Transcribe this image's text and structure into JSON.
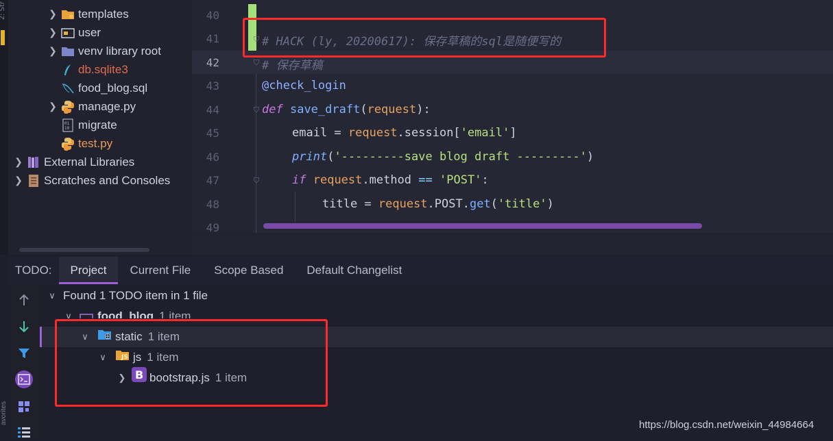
{
  "left_strip": {
    "vertical_text": "2: Str"
  },
  "project_tree": {
    "items": [
      {
        "label": "templates",
        "icon": "folder-icon"
      },
      {
        "label": "user",
        "icon": "folder-icon"
      },
      {
        "label": "venv  library root",
        "icon": "folder-icon"
      },
      {
        "label": "db.sqlite3",
        "icon": "feather-icon"
      },
      {
        "label": "food_blog.sql",
        "icon": "sql-file-icon"
      },
      {
        "label": "manage.py",
        "icon": "python-icon"
      },
      {
        "label": "migrate",
        "icon": "binary-file-icon"
      },
      {
        "label": "test.py",
        "icon": "python-icon"
      },
      {
        "label": "External Libraries",
        "icon": "library-icon"
      },
      {
        "label": "Scratches and Consoles",
        "icon": "scratches-icon"
      }
    ]
  },
  "editor": {
    "line_numbers": [
      "40",
      "41",
      "42",
      "43",
      "44",
      "45",
      "46",
      "47",
      "48",
      "49"
    ],
    "lines": {
      "l41": "# HACK (ly, 20200617): 保存草稿的sql是随便写的",
      "l42": "# 保存草稿",
      "l43": "@check_login",
      "l44_kw": "def",
      "l44_fn": "save_draft",
      "l44_param": "request",
      "l45_a": "email = ",
      "l45_b": "request",
      "l45_c": ".session[",
      "l45_str": "'email'",
      "l45_d": "]",
      "l46_fn": "print",
      "l46_str": "'---------save blog draft ---------'",
      "l47_kw": "if",
      "l47_a": "request",
      "l47_b": ".method ",
      "l47_op": "==",
      "l47_str": "'POST'",
      "l48_a": "title = ",
      "l48_b": "request",
      "l48_c": ".POST.",
      "l48_fn": "get",
      "l48_str": "'title'"
    }
  },
  "todo": {
    "header": "TODO:",
    "tabs": [
      "Project",
      "Current File",
      "Scope Based",
      "Default Changelist"
    ],
    "summary": "Found 1 TODO item in 1 file",
    "nodes": [
      {
        "label": "food_blog",
        "count": "1 item"
      },
      {
        "label": "static",
        "count": "1 item"
      },
      {
        "label": "js",
        "count": "1 item"
      },
      {
        "label": "bootstrap.js",
        "count": "1 item"
      }
    ]
  },
  "colors": {
    "highlight_box": "#ff2a2a",
    "accent": "#a05ed8"
  },
  "watermark": "https://blog.csdn.net/weixin_44984664"
}
